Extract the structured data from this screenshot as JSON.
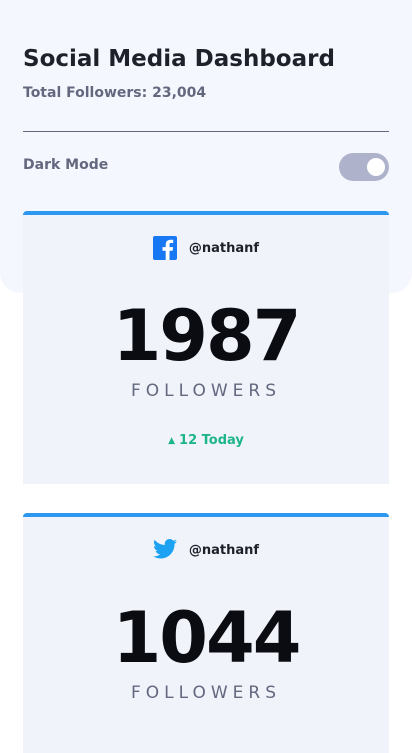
{
  "header": {
    "title": "Social Media Dashboard",
    "subtitle": "Total Followers: 23,004",
    "dark_mode_label": "Dark Mode",
    "dark_mode_on": true
  },
  "colors": {
    "facebook": "#1877f2",
    "twitter": "#1da1f2",
    "accent_bar": "#2c98f0",
    "up_green": "#1eb589"
  },
  "cards": [
    {
      "platform_icon": "facebook-icon",
      "handle": "@nathanf",
      "count": "1987",
      "label": "FOLLOWERS",
      "today_arrow": "▲",
      "today_text": "12 Today"
    },
    {
      "platform_icon": "twitter-icon",
      "handle": "@nathanf",
      "count": "1044",
      "label": "FOLLOWERS"
    }
  ]
}
